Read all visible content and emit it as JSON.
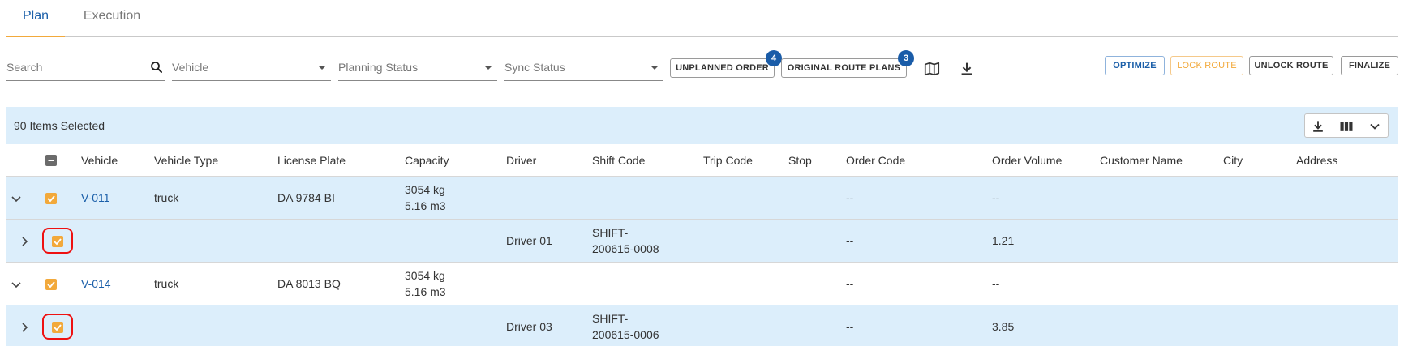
{
  "tabs": [
    {
      "label": "Plan",
      "active": true
    },
    {
      "label": "Execution",
      "active": false
    }
  ],
  "filters": {
    "search_placeholder": "Search",
    "vehicle_placeholder": "Vehicle",
    "planning_status_placeholder": "Planning Status",
    "sync_status_placeholder": "Sync Status"
  },
  "toolbar": {
    "unplanned_order_label": "UNPLANNED ORDER",
    "unplanned_order_count": "4",
    "original_route_plans_label": "ORIGINAL ROUTE PLANS",
    "original_route_plans_count": "3",
    "optimize_label": "OPTIMIZE",
    "lock_route_label": "LOCK ROUTE",
    "unlock_route_label": "UNLOCK ROUTE",
    "finalize_label": "FINALIZE"
  },
  "selection": {
    "count_text": "90 Items Selected"
  },
  "table": {
    "columns": [
      "Vehicle",
      "Vehicle Type",
      "License Plate",
      "Capacity",
      "Driver",
      "Shift Code",
      "Trip Code",
      "Stop",
      "Order Code",
      "Order Volume",
      "Customer Name",
      "City",
      "Address"
    ],
    "rows": [
      {
        "kind": "vehicle",
        "vehicle": "V-011",
        "vehicle_type": "truck",
        "license_plate": "DA 9784 BI",
        "capacity_weight": "3054 kg",
        "capacity_volume": "5.16 m3",
        "order_code": "--",
        "order_volume": "--"
      },
      {
        "kind": "shift",
        "driver": "Driver 01",
        "shift_code_line1": "SHIFT-",
        "shift_code_line2": "200615-0008",
        "order_code": "--",
        "order_volume": "1.21"
      },
      {
        "kind": "vehicle",
        "vehicle": "V-014",
        "vehicle_type": "truck",
        "license_plate": "DA 8013 BQ",
        "capacity_weight": "3054 kg",
        "capacity_volume": "5.16 m3",
        "order_code": "--",
        "order_volume": "--"
      },
      {
        "kind": "shift",
        "driver": "Driver 03",
        "shift_code_line1": "SHIFT-",
        "shift_code_line2": "200615-0006",
        "order_code": "--",
        "order_volume": "3.85"
      }
    ]
  },
  "colors": {
    "accent_blue": "#1b5fa9",
    "accent_orange": "#f2a93b",
    "selection_bg": "#dceefb",
    "badge_blue": "#1a5ca8",
    "highlight_red": "#e11111"
  },
  "icons": [
    "search-icon",
    "map-icon",
    "download-icon",
    "columns-icon",
    "chevron-down-icon",
    "chevron-right-icon",
    "checkbox-checked-icon",
    "checkbox-indeterminate-icon"
  ]
}
